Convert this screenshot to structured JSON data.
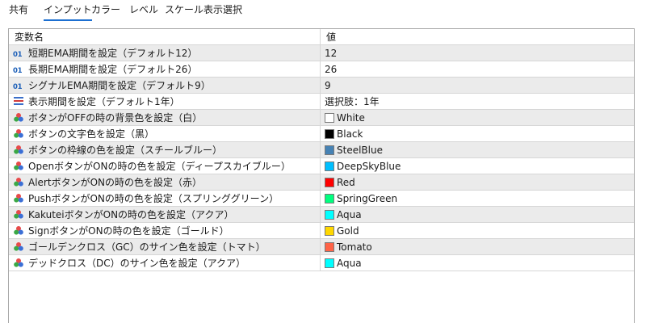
{
  "tabs": [
    {
      "label": "共有",
      "active": false
    },
    {
      "label": "インプット",
      "active": true
    },
    {
      "label": "カラー",
      "active": false
    },
    {
      "label": "レベル",
      "active": false
    },
    {
      "label": "スケール",
      "active": false
    },
    {
      "label": "表示選択",
      "active": false
    }
  ],
  "table": {
    "headers": {
      "name": "変数名",
      "value": "値"
    },
    "rows": [
      {
        "icon": "integer-icon",
        "icon_text": "01",
        "name": "短期EMA期間を設定（デフォルト12）",
        "value": "12",
        "swatch": null
      },
      {
        "icon": "integer-icon",
        "icon_text": "01",
        "name": "長期EMA期間を設定（デフォルト26）",
        "value": "26",
        "swatch": null
      },
      {
        "icon": "integer-icon",
        "icon_text": "01",
        "name": "シグナルEMA期間を設定（デフォルト9）",
        "value": "9",
        "swatch": null
      },
      {
        "icon": "enum-list-icon",
        "icon_text": "",
        "name": "表示期間を設定（デフォルト1年）",
        "value": "選択肢：1年",
        "swatch": null
      },
      {
        "icon": "color-palette-icon",
        "icon_text": "",
        "name": "ボタンがOFFの時の背景色を設定（白）",
        "value": "White",
        "swatch": "#ffffff"
      },
      {
        "icon": "color-palette-icon",
        "icon_text": "",
        "name": "ボタンの文字色を設定（黒）",
        "value": "Black",
        "swatch": "#000000"
      },
      {
        "icon": "color-palette-icon",
        "icon_text": "",
        "name": "ボタンの枠線の色を設定（スチールブルー）",
        "value": "SteelBlue",
        "swatch": "#4682b4"
      },
      {
        "icon": "color-palette-icon",
        "icon_text": "",
        "name": "OpenボタンがONの時の色を設定（ディープスカイブルー）",
        "value": "DeepSkyBlue",
        "swatch": "#00bfff"
      },
      {
        "icon": "color-palette-icon",
        "icon_text": "",
        "name": "AlertボタンがONの時の色を設定（赤）",
        "value": "Red",
        "swatch": "#ff0000"
      },
      {
        "icon": "color-palette-icon",
        "icon_text": "",
        "name": "PushボタンがONの時の色を設定（スプリンググリーン）",
        "value": "SpringGreen",
        "swatch": "#00ff7f"
      },
      {
        "icon": "color-palette-icon",
        "icon_text": "",
        "name": "KakuteiボタンがONの時の色を設定（アクア）",
        "value": "Aqua",
        "swatch": "#00ffff"
      },
      {
        "icon": "color-palette-icon",
        "icon_text": "",
        "name": "SignボタンがONの時の色を設定（ゴールド）",
        "value": "Gold",
        "swatch": "#ffd700"
      },
      {
        "icon": "color-palette-icon",
        "icon_text": "",
        "name": "ゴールデンクロス（GC）のサイン色を設定（トマト）",
        "value": "Tomato",
        "swatch": "#ff6347"
      },
      {
        "icon": "color-palette-icon",
        "icon_text": "",
        "name": "デッドクロス（DC）のサイン色を設定（アクア）",
        "value": "Aqua",
        "swatch": "#00ffff"
      }
    ]
  },
  "colors": {
    "accent": "#1c6fd1",
    "alt_row": "#ebebeb",
    "grid": "#d6d6d6"
  }
}
